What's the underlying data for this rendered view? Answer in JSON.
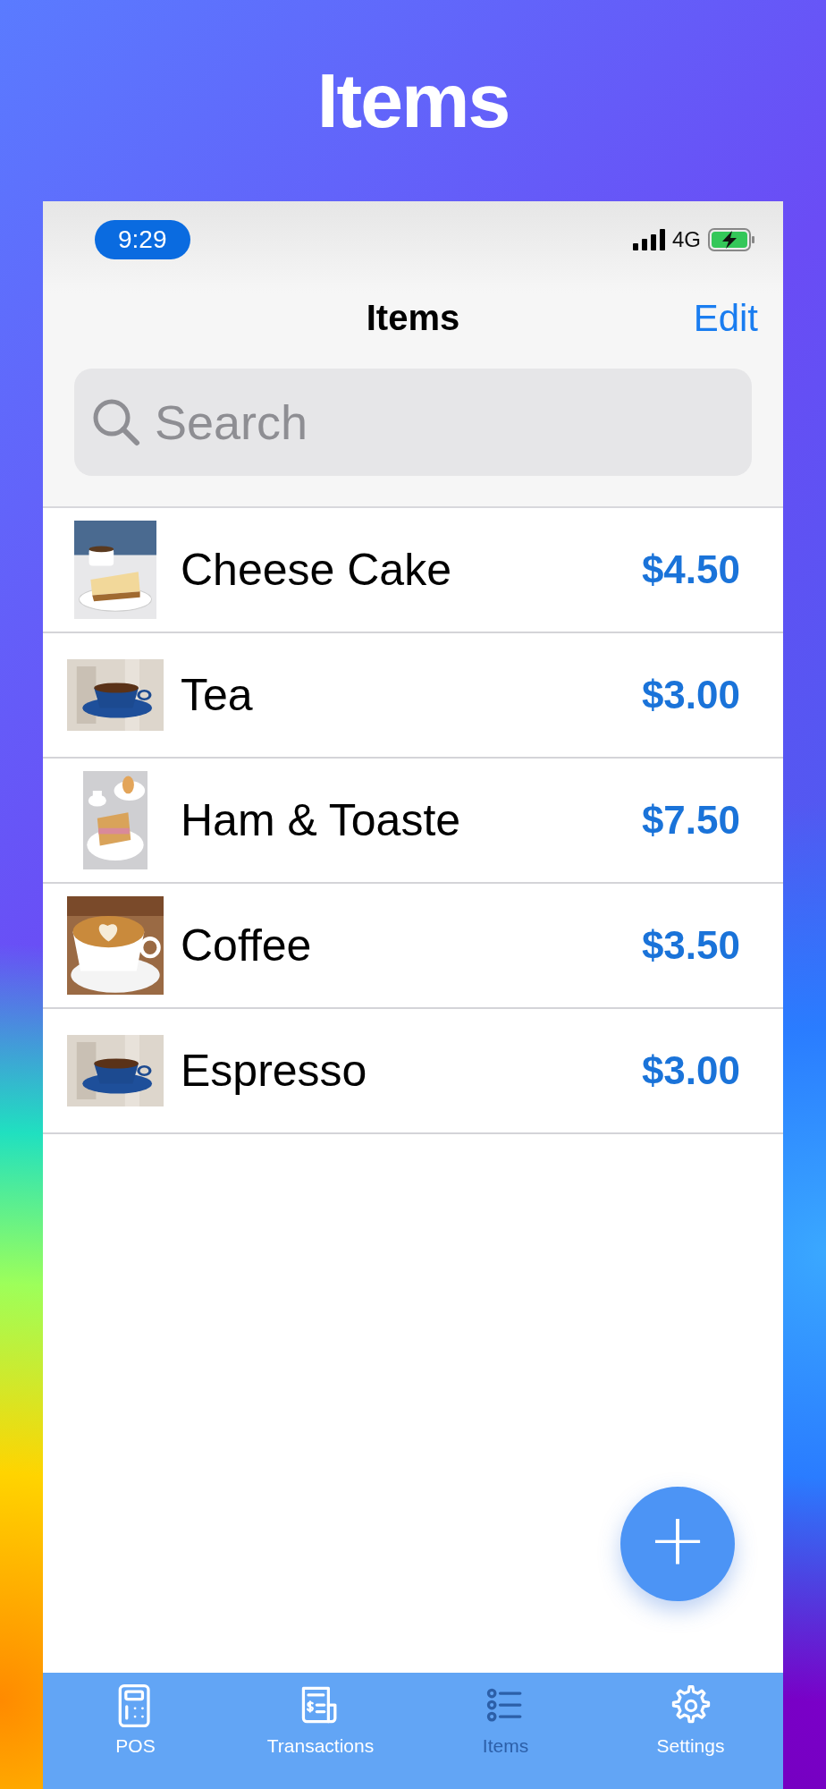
{
  "headline": "Items",
  "status_bar": {
    "time": "9:29",
    "network": "4G",
    "charging": true
  },
  "nav": {
    "title": "Items",
    "action": "Edit"
  },
  "search": {
    "placeholder": "Search"
  },
  "items": [
    {
      "name": "Cheese Cake",
      "price": "$4.50"
    },
    {
      "name": "Tea",
      "price": "$3.00"
    },
    {
      "name": "Ham & Toaste",
      "price": "$7.50"
    },
    {
      "name": "Coffee",
      "price": "$3.50"
    },
    {
      "name": "Espresso",
      "price": "$3.00"
    }
  ],
  "add_button": {
    "label": "+"
  },
  "tab_bar": [
    {
      "label": "POS",
      "selected": false
    },
    {
      "label": "Transactions",
      "selected": false
    },
    {
      "label": "Items",
      "selected": true
    },
    {
      "label": "Settings",
      "selected": false
    }
  ]
}
